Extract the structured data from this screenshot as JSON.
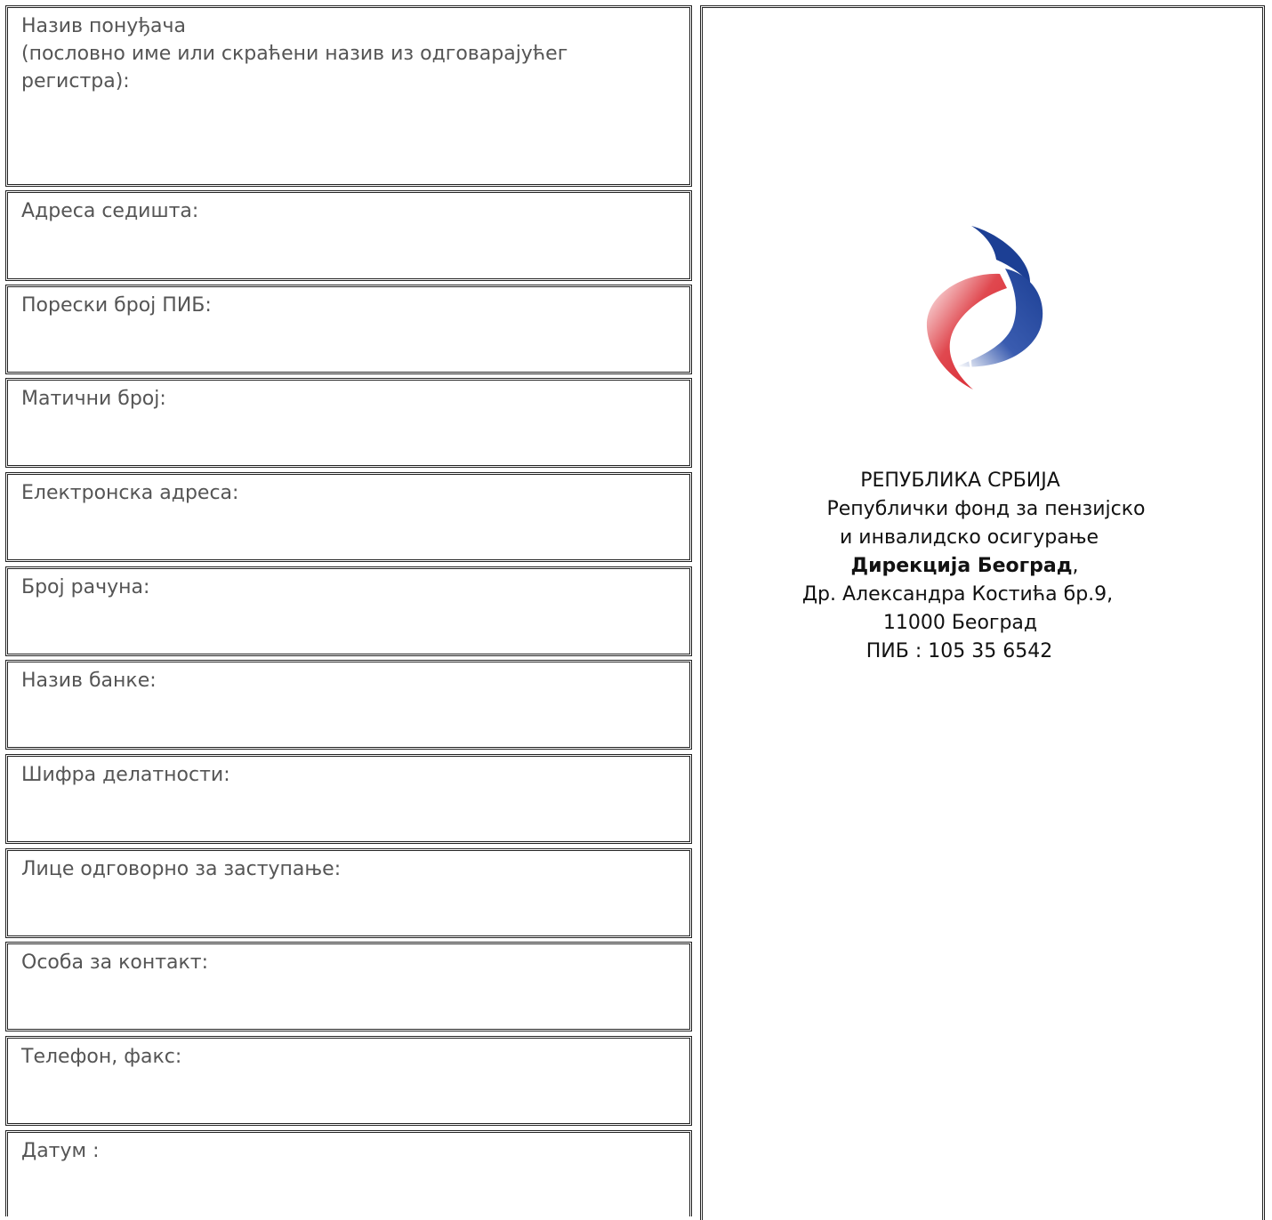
{
  "form": {
    "fields": [
      "Назив понуђача\n(пословно име или скраћени назив из одговарајућег регистра):",
      "Адреса седишта:",
      "Порески број ПИБ:",
      "Матични број:",
      "Електронска адреса:",
      "Број рачуна:",
      "Назив банке:",
      "Шифра делатности:",
      "Лице одговорно за заступање:",
      "Особа за контакт:",
      "Телефон, факс:",
      "Датум :"
    ]
  },
  "recipient": {
    "country": "РЕПУБЛИКА СРБИЈА",
    "fund_line1": "Републички фонд за пензијско",
    "fund_line2": "и инвалидско осигурање",
    "directorate": "Дирекција Београд",
    "directorate_suffix": ",",
    "street": "Др. Александра Костића бр.9,",
    "city": "11000 Београд",
    "pib": "ПИБ : 105 35 6542"
  },
  "colors": {
    "logo_blue": "#1c3f94",
    "logo_red": "#d7202a"
  }
}
